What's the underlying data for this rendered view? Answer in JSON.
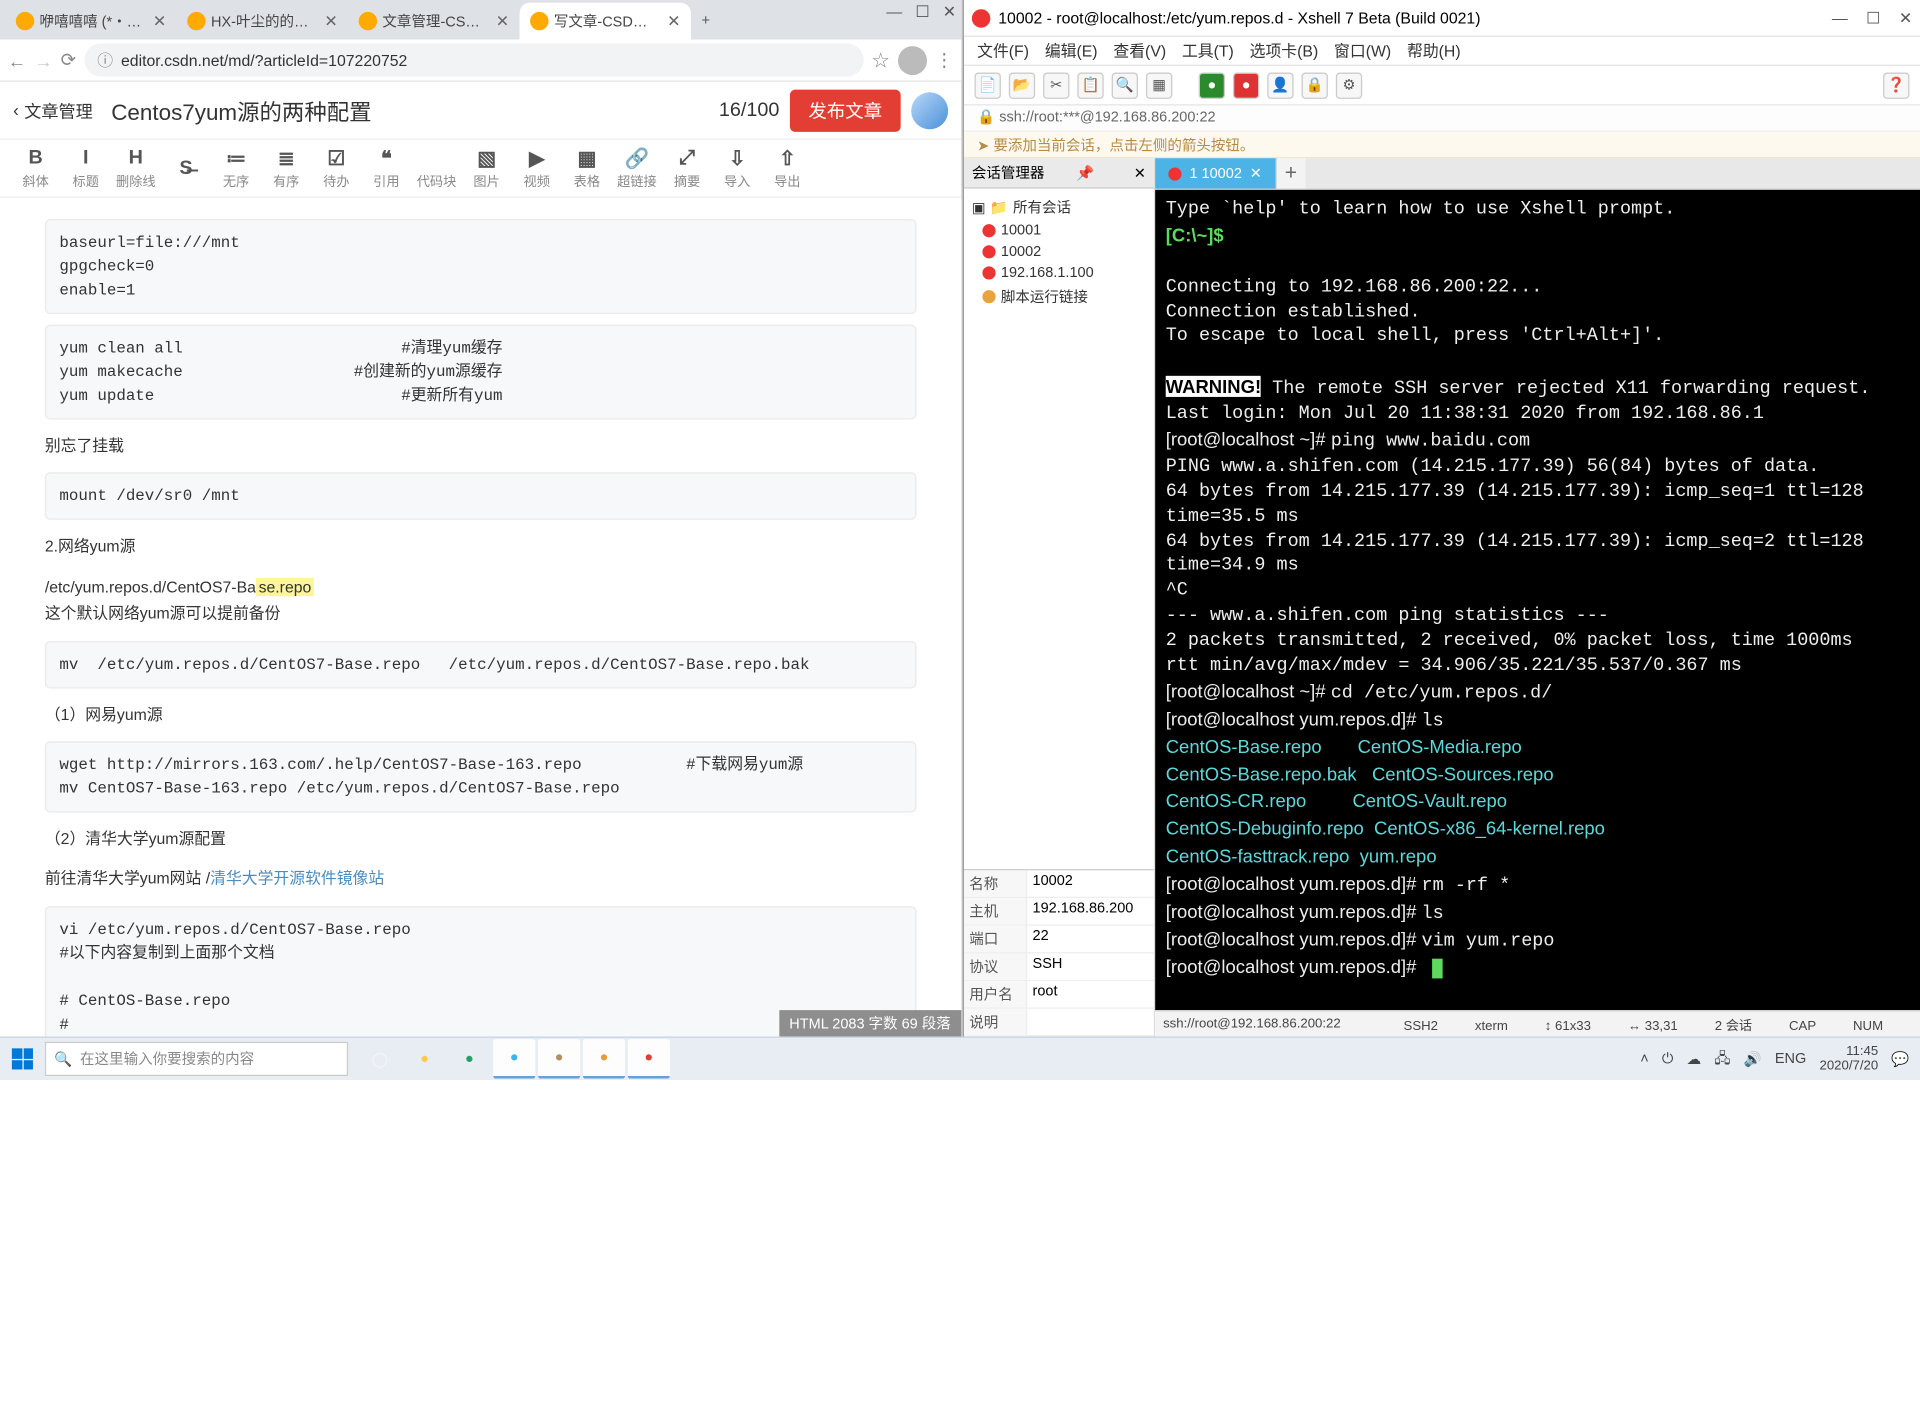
{
  "chrome": {
    "tabs": [
      {
        "title": "咿嘻嘻嘻 (*・ω・)ノ",
        "active": false
      },
      {
        "title": "HX-叶尘的的个人空间",
        "active": false
      },
      {
        "title": "文章管理-CSDN博客",
        "active": false
      },
      {
        "title": "写文章-CSDN博客",
        "active": true
      }
    ],
    "url": "editor.csdn.net/md/?articleId=107220752",
    "win_btns": [
      "—",
      "☐",
      "✕"
    ]
  },
  "csdn": {
    "back": "文章管理",
    "title": "Centos7yum源的两种配置",
    "counter": "16/100",
    "publish": "发布文章",
    "toolbar": [
      {
        "ic": "B",
        "lb": "斜体"
      },
      {
        "ic": "I",
        "lb": "标题"
      },
      {
        "ic": "H",
        "lb": "删除线"
      },
      {
        "ic": "S̶",
        "lb": ""
      },
      {
        "ic": "≔",
        "lb": "无序"
      },
      {
        "ic": "≣",
        "lb": "有序"
      },
      {
        "ic": "☑",
        "lb": "待办"
      },
      {
        "ic": "❝",
        "lb": "引用"
      },
      {
        "ic": "</>",
        "lb": "代码块"
      },
      {
        "ic": "▧",
        "lb": "图片"
      },
      {
        "ic": "▶",
        "lb": "视频"
      },
      {
        "ic": "▦",
        "lb": "表格"
      },
      {
        "ic": "🔗",
        "lb": "超链接"
      },
      {
        "ic": "⤢",
        "lb": "摘要"
      },
      {
        "ic": "⇩",
        "lb": "导入"
      },
      {
        "ic": "⇧",
        "lb": "导出"
      }
    ],
    "code1": "baseurl=file:///mnt\ngpgcheck=0\nenable=1",
    "code2": "yum clean all                       #清理yum缓存\nyum makecache                  #创建新的yum源缓存\nyum update                          #更新所有yum",
    "p1": "别忘了挂载",
    "code3": "mount /dev/sr0 /mnt",
    "p2": "2.网络yum源",
    "p3a": "/etc/yum.repos.d/CentOS7-Ba",
    "p3hl": "se.repo",
    "p3b": "这个默认网络yum源可以提前备份",
    "code4": "mv  /etc/yum.repos.d/CentOS7-Base.repo   /etc/yum.repos.d/CentOS7-Base.repo.bak",
    "p4": "（1）网易yum源",
    "code5": "wget http://mirrors.163.com/.help/CentOS7-Base-163.repo           #下载网易yum源\nmv CentOS7-Base-163.repo /etc/yum.repos.d/CentOS7-Base.repo",
    "p5": "（2）清华大学yum源配置",
    "p6": "前往清华大学yum网站 /",
    "p6link": "清华大学开源软件镜像站",
    "code6": "vi /etc/yum.repos.d/CentOS7-Base.repo\n#以下内容复制到上面那个文档\n\n# CentOS-Base.repo\n#\n# The mirror system uses the connecting IP address of the client and the",
    "status": "HTML  2083 字数  69 段落"
  },
  "xshell": {
    "title": "10002 - root@localhost:/etc/yum.repos.d - Xshell 7 Beta (Build 0021)",
    "menus": [
      "文件(F)",
      "编辑(E)",
      "查看(V)",
      "工具(T)",
      "选项卡(B)",
      "窗口(W)",
      "帮助(H)"
    ],
    "path": "ssh://root:***@192.168.86.200:22",
    "hint": "➤ 要添加当前会话，点击左侧的箭头按钮。",
    "session_hdr": "会话管理器",
    "tree": {
      "root": "所有会话",
      "items": [
        "10001",
        "10002",
        "192.168.1.100",
        "脚本运行链接"
      ]
    },
    "props": [
      {
        "k": "名称",
        "v": "10002"
      },
      {
        "k": "主机",
        "v": "192.168.86.200"
      },
      {
        "k": "端口",
        "v": "22"
      },
      {
        "k": "协议",
        "v": "SSH"
      },
      {
        "k": "用户名",
        "v": "root"
      },
      {
        "k": "说明",
        "v": ""
      }
    ],
    "tab": "1 10002",
    "term_lines": [
      {
        "t": "Type `help' to learn how to use Xshell prompt."
      },
      {
        "prompt": "[C:\\~]$ ",
        "rest": ""
      },
      {
        "t": ""
      },
      {
        "t": "Connecting to 192.168.86.200:22..."
      },
      {
        "t": "Connection established."
      },
      {
        "t": "To escape to local shell, press 'Ctrl+Alt+]'."
      },
      {
        "t": ""
      },
      {
        "warn": "WARNING!",
        "rest": " The remote SSH server rejected X11 forwarding request."
      },
      {
        "t": "Last login: Mon Jul 20 11:38:31 2020 from 192.168.86.1"
      },
      {
        "p": "[root@localhost ~]# ",
        "cmd": "ping www.baidu.com"
      },
      {
        "t": "PING www.a.shifen.com (14.215.177.39) 56(84) bytes of data."
      },
      {
        "t": "64 bytes from 14.215.177.39 (14.215.177.39): icmp_seq=1 ttl=128 time=35.5 ms"
      },
      {
        "t": "64 bytes from 14.215.177.39 (14.215.177.39): icmp_seq=2 ttl=128 time=34.9 ms"
      },
      {
        "t": "^C"
      },
      {
        "t": "--- www.a.shifen.com ping statistics ---"
      },
      {
        "t": "2 packets transmitted, 2 received, 0% packet loss, time 1000ms"
      },
      {
        "t": "rtt min/avg/max/mdev = 34.906/35.221/35.537/0.367 ms"
      },
      {
        "p": "[root@localhost ~]# ",
        "cmd": "cd /etc/yum.repos.d/"
      },
      {
        "p": "[root@localhost yum.repos.d]# ",
        "cmd": "ls"
      },
      {
        "ls": "CentOS-Base.repo       CentOS-Media.repo"
      },
      {
        "ls": "CentOS-Base.repo.bak   CentOS-Sources.repo"
      },
      {
        "ls": "CentOS-CR.repo         CentOS-Vault.repo"
      },
      {
        "ls": "CentOS-Debuginfo.repo  CentOS-x86_64-kernel.repo"
      },
      {
        "ls": "CentOS-fasttrack.repo  yum.repo"
      },
      {
        "p": "[root@localhost yum.repos.d]# ",
        "cmd": "rm -rf *"
      },
      {
        "p": "[root@localhost yum.repos.d]# ",
        "cmd": "ls"
      },
      {
        "p": "[root@localhost yum.repos.d]# ",
        "cmd": "vim yum.repo"
      },
      {
        "p": "[root@localhost yum.repos.d]# ",
        "cursor": true
      }
    ],
    "status": {
      "left": "ssh://root@192.168.86.200:22",
      "items": [
        "SSH2",
        "xterm",
        "↕ 61x33",
        "↔ 33,31",
        "2 会话",
        "CAP",
        "NUM"
      ]
    }
  },
  "taskbar": {
    "search_placeholder": "在这里输入你要搜索的内容",
    "time": "11:45",
    "date": "2020/7/20",
    "lang": "ENG",
    "app_colors": [
      "#f7f7f7",
      "#ffcb44",
      "#1fa463",
      "#3eb2f0",
      "#b39162",
      "#e89a3c",
      "#e33e33"
    ]
  }
}
